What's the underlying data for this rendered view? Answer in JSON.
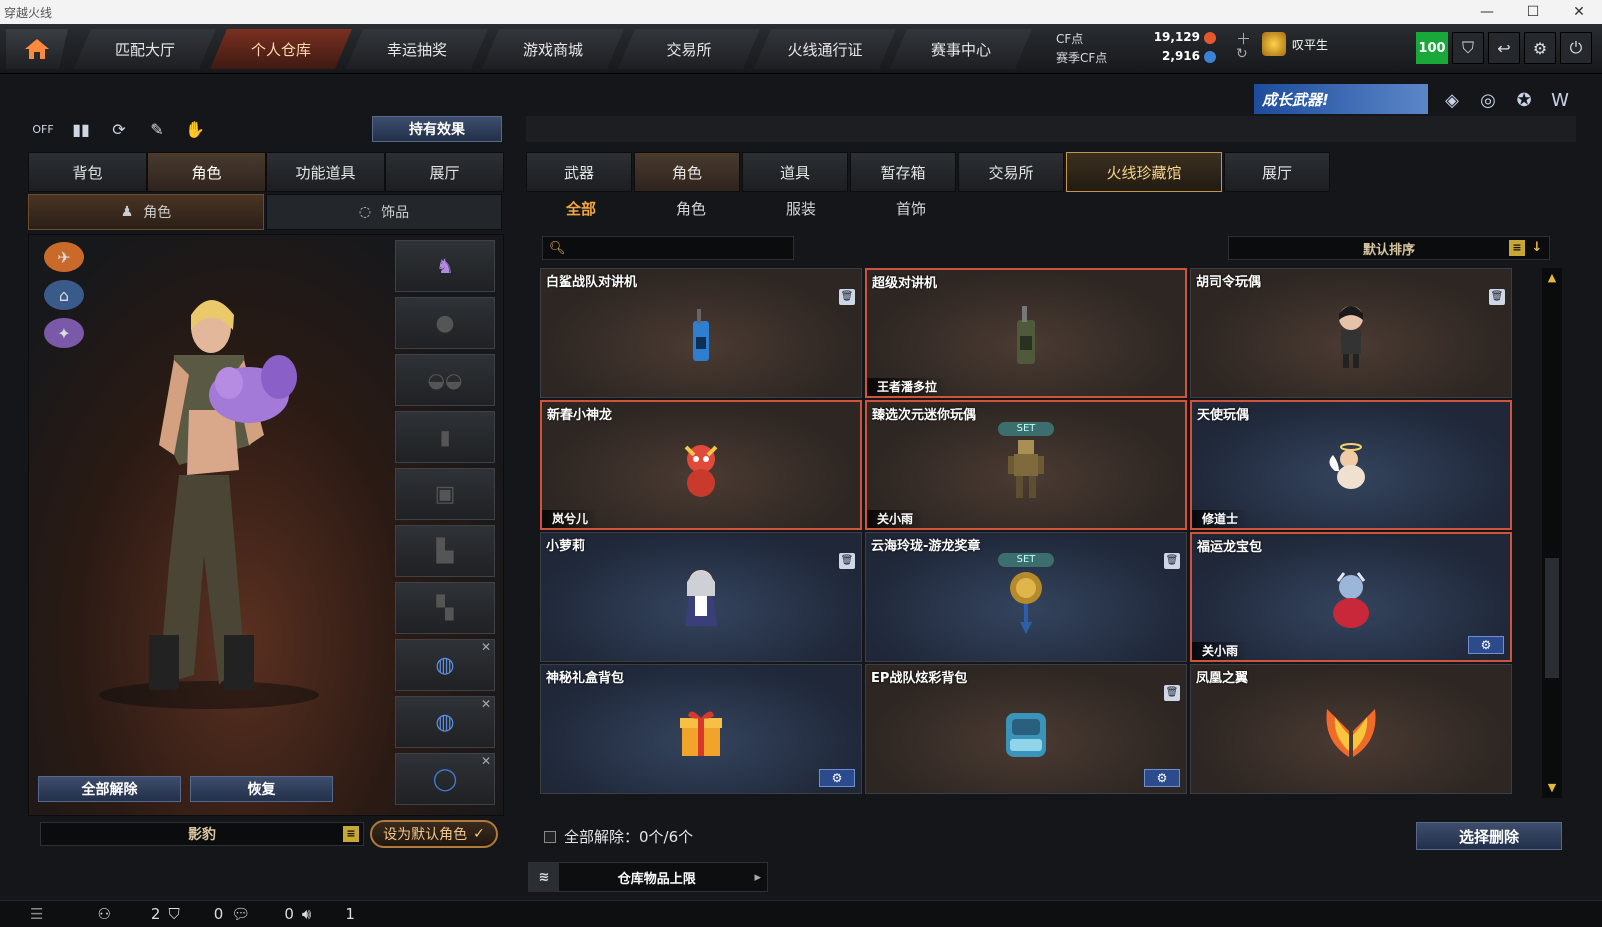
{
  "window": {
    "title": "穿越火线"
  },
  "nav": {
    "tabs": [
      "匹配大厅",
      "个人仓库",
      "幸运抽奖",
      "游戏商城",
      "交易所",
      "火线通行证",
      "赛事中心"
    ],
    "active": 1
  },
  "currency": {
    "cf_label": "CF点",
    "cf_value": "19,129",
    "season_label": "赛季CF点",
    "season_value": "2,916"
  },
  "player": {
    "rank_name": "叹平生",
    "level": "100"
  },
  "banner": {
    "text": "成长武器!"
  },
  "left": {
    "effect_button": "持有效果",
    "tabs": [
      "背包",
      "角色",
      "功能道具",
      "展厅"
    ],
    "active_tab": 1,
    "subtabs": [
      "角色",
      "饰品"
    ],
    "active_subtab": 0,
    "unequip_all": "全部解除",
    "restore": "恢复",
    "character_name": "影豹",
    "set_default": "设为默认角色"
  },
  "right": {
    "tabs": [
      "武器",
      "角色",
      "道具",
      "暂存箱",
      "交易所",
      "火线珍藏馆",
      "展厅"
    ],
    "active_tab": 1,
    "filters": [
      "全部",
      "角色",
      "服装",
      "首饰"
    ],
    "active_filter": 0,
    "search_placeholder": "",
    "sort_label": "默认排序",
    "items": [
      {
        "name": "白鲨战队对讲机",
        "owner": "",
        "theme": "brown",
        "trash": true,
        "gear": false,
        "set": false,
        "sel": false,
        "icon": "walkie-talkie-blue"
      },
      {
        "name": "超级对讲机",
        "owner": "王者潘多拉",
        "theme": "brown",
        "trash": false,
        "gear": false,
        "set": false,
        "sel": true,
        "icon": "walkie-talkie-green"
      },
      {
        "name": "胡司令玩偶",
        "owner": "",
        "theme": "brown",
        "trash": true,
        "gear": false,
        "set": false,
        "sel": false,
        "icon": "doll-figure"
      },
      {
        "name": "新春小神龙",
        "owner": "岚兮儿",
        "theme": "brown",
        "trash": false,
        "gear": false,
        "set": false,
        "sel": true,
        "icon": "dragon-figure"
      },
      {
        "name": "臻选次元迷你玩偶",
        "owner": "关小雨",
        "theme": "brown",
        "trash": false,
        "gear": false,
        "set": true,
        "sel": true,
        "icon": "mech-figure"
      },
      {
        "name": "天使玩偶",
        "owner": "修道士",
        "theme": "blue",
        "trash": false,
        "gear": false,
        "set": false,
        "sel": true,
        "icon": "angel-figure"
      },
      {
        "name": "小萝莉",
        "owner": "",
        "theme": "blue",
        "trash": true,
        "gear": false,
        "set": false,
        "sel": false,
        "icon": "girl-figure"
      },
      {
        "name": "云海玲珑-游龙奖章",
        "owner": "",
        "theme": "blue",
        "trash": true,
        "gear": false,
        "set": true,
        "sel": false,
        "icon": "medal"
      },
      {
        "name": "福运龙宝包",
        "owner": "关小雨",
        "theme": "blue",
        "trash": false,
        "gear": true,
        "set": false,
        "sel": true,
        "icon": "dragon-bag"
      },
      {
        "name": "神秘礼盒背包",
        "owner": "",
        "theme": "blue",
        "trash": false,
        "gear": true,
        "set": false,
        "sel": false,
        "icon": "gift-box"
      },
      {
        "name": "EP战队炫彩背包",
        "owner": "",
        "theme": "brown",
        "trash": true,
        "gear": true,
        "set": false,
        "sel": false,
        "icon": "backpack"
      },
      {
        "name": "凤凰之翼",
        "owner": "",
        "theme": "brown",
        "trash": false,
        "gear": false,
        "set": false,
        "sel": false,
        "icon": "phoenix-wings"
      }
    ],
    "unequip_label": "全部解除：0个/6个",
    "delete_button": "选择删除",
    "capacity_label": "仓库物品上限",
    "set_tag": "SET"
  },
  "status": {
    "count1": "2",
    "count2": "0",
    "count3": "0",
    "count4": "1"
  }
}
